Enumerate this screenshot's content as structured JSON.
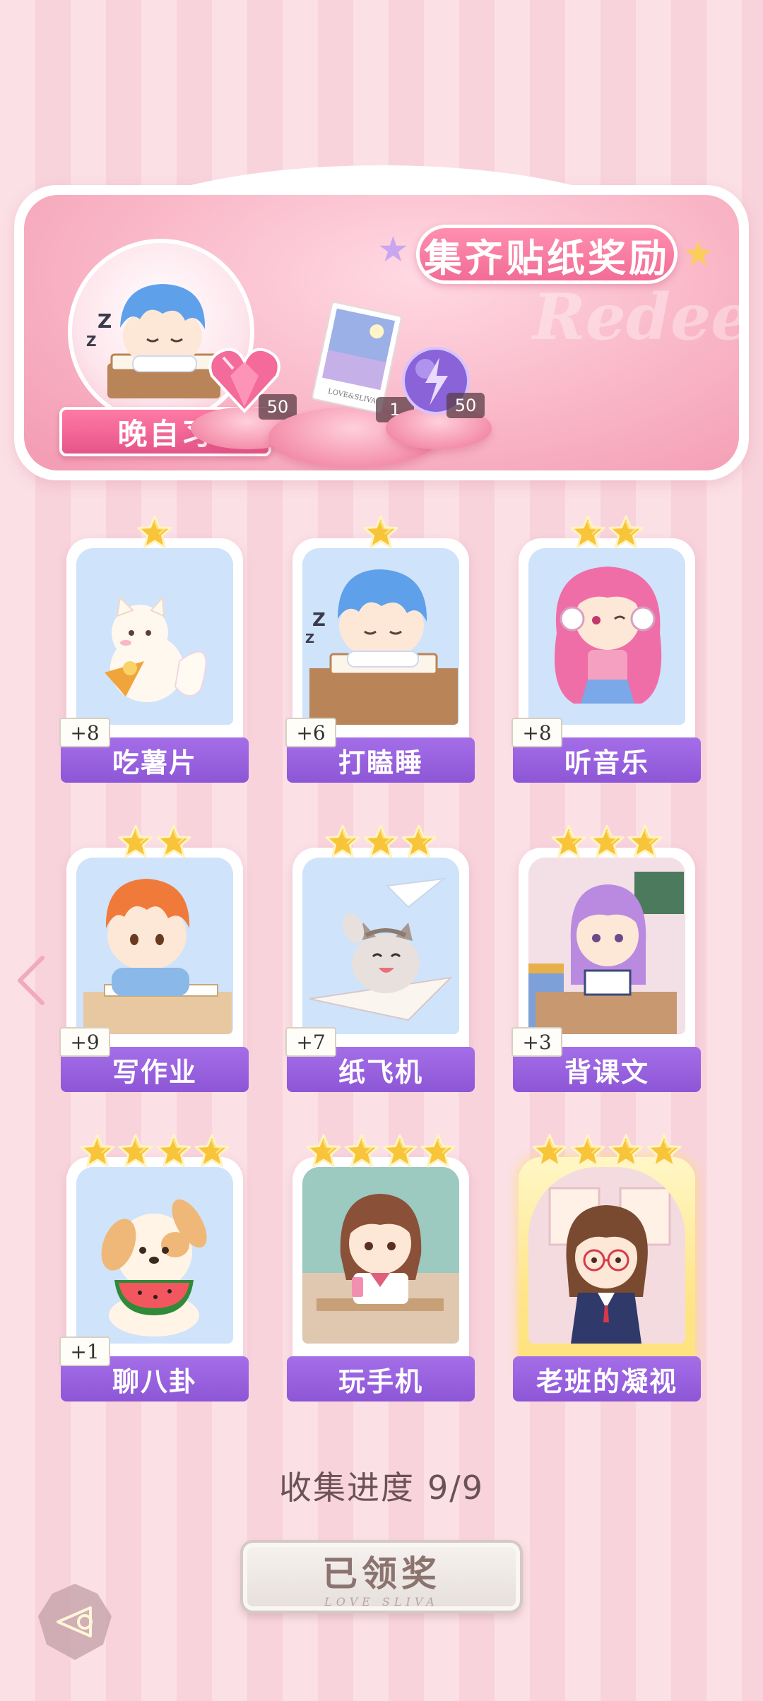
{
  "banner": {
    "title": "集齐贴纸奖励",
    "watermark": "Redeem",
    "theme_label": "晚自习",
    "rewards": [
      {
        "icon": "pink-heart-gem-icon",
        "count": "50"
      },
      {
        "icon": "photo-card-icon",
        "count": "1",
        "photo_caption": "LOVE&SLIVA"
      },
      {
        "icon": "purple-energy-orb-icon",
        "count": "50"
      }
    ]
  },
  "cards": [
    {
      "label": "吃薯片",
      "bonus": "+8",
      "stars": 1,
      "art": "white-fox-eating-chips"
    },
    {
      "label": "打瞌睡",
      "bonus": "+6",
      "stars": 1,
      "art": "blue-hair-boy-sleeping"
    },
    {
      "label": "听音乐",
      "bonus": "+8",
      "stars": 2,
      "art": "pink-hair-girl-headphones"
    },
    {
      "label": "写作业",
      "bonus": "+9",
      "stars": 2,
      "art": "orange-hair-boy-homework"
    },
    {
      "label": "纸飞机",
      "bonus": "+7",
      "stars": 3,
      "art": "cat-paper-plane"
    },
    {
      "label": "背课文",
      "bonus": "+3",
      "stars": 3,
      "art": "purple-hair-girl-reciting"
    },
    {
      "label": "聊八卦",
      "bonus": "+1",
      "stars": 4,
      "art": "puppy-watermelon"
    },
    {
      "label": "玩手机",
      "bonus": "",
      "stars": 4,
      "art": "girl-playing-phone"
    },
    {
      "label": "老班的凝视",
      "bonus": "",
      "stars": 4,
      "art": "teacher-stare",
      "special": true
    }
  ],
  "progress": {
    "label": "收集进度",
    "value": "9/9"
  },
  "claim_button": {
    "label": "已领奖",
    "sub": "LOVE SLIVA"
  },
  "colors": {
    "accent_pink": "#f26c96",
    "label_purple": "#9a62e0",
    "star_gold": "#f8c53a"
  }
}
